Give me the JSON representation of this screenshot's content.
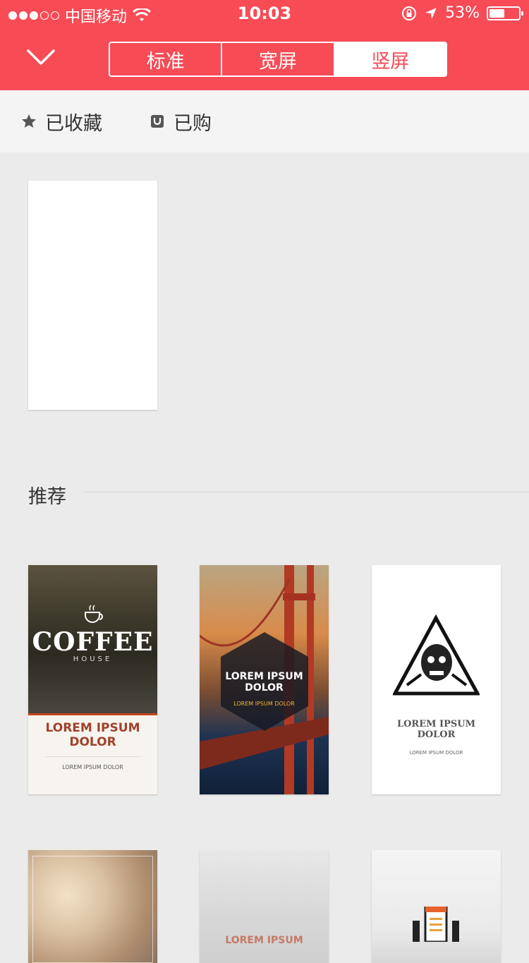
{
  "status_bar": {
    "carrier": "中国移动",
    "time": "10:03",
    "battery": "53%",
    "battery_level": 0.53
  },
  "header": {
    "collapse_icon": "chevron-down-icon",
    "tabs": [
      {
        "label": "标准",
        "active": false
      },
      {
        "label": "宽屏",
        "active": false
      },
      {
        "label": "竖屏",
        "active": true
      }
    ],
    "accent_color": "#f74b56"
  },
  "filters": {
    "favorites": {
      "label": "已收藏",
      "icon": "star-icon"
    },
    "purchased": {
      "label": "已购",
      "icon": "bag-icon"
    }
  },
  "section": {
    "title": "推荐"
  },
  "templates": {
    "coffee": {
      "logo": "COFFEE",
      "logo_sub": "HOUSE",
      "heading_1": "LOREM IPSUM",
      "heading_2": "DOLOR",
      "footer": "LOREM IPSUM DOLOR"
    },
    "bridge": {
      "heading_1": "LOREM IPSUM",
      "heading_2": "DOLOR",
      "footer": "LOREM IPSUM DOLOR"
    },
    "skull": {
      "heading_1": "LOREM IPSUM",
      "heading_2": "DOLOR",
      "footer": "LOREM IPSUM DOLOR"
    },
    "blur": {
      "heading": "LOREM IPSUM"
    }
  }
}
